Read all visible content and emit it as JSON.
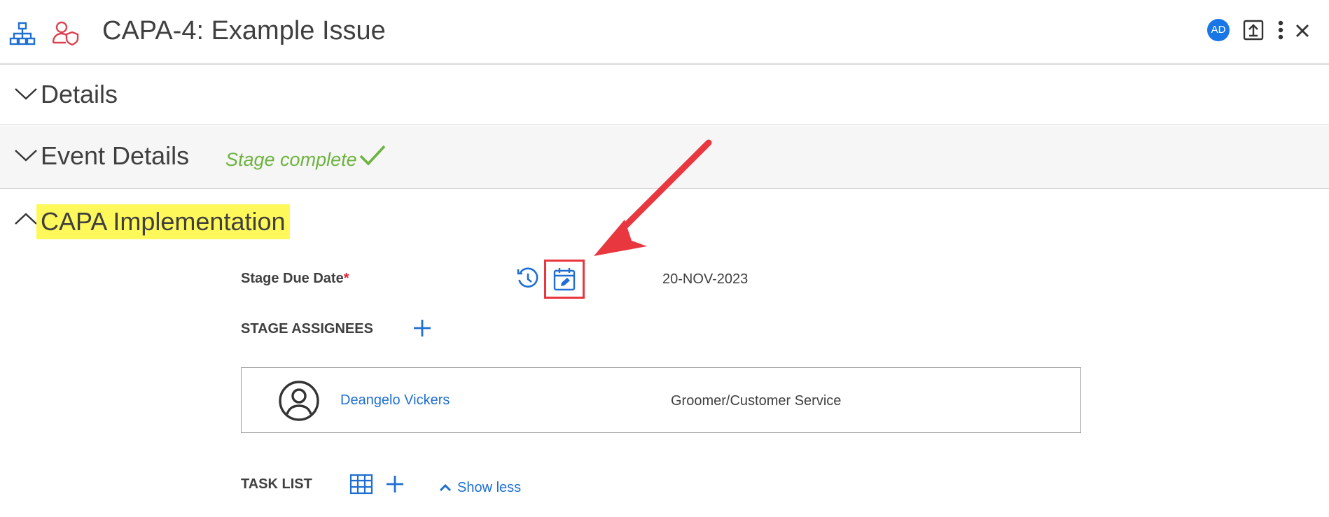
{
  "header": {
    "title": "CAPA-4: Example Issue",
    "avatar_initials": "AD",
    "icons": [
      "org-chart-icon",
      "user-shield-icon",
      "export-icon",
      "kebab-menu-icon",
      "close-icon"
    ]
  },
  "sections": {
    "details": {
      "title": "Details",
      "state": "collapsed"
    },
    "event_details": {
      "title": "Event Details",
      "state": "collapsed",
      "status": "Stage complete"
    },
    "capa_implementation": {
      "title": "CAPA Implementation",
      "state": "expanded"
    }
  },
  "capa": {
    "stage_due_date_label": "Stage Due Date",
    "required_mark": "*",
    "stage_due_date_value": "20-NOV-2023",
    "stage_assignees_label": "STAGE ASSIGNEES",
    "assignee": {
      "name": "Deangelo Vickers",
      "role": "Groomer/Customer Service"
    },
    "task_list_label": "TASK LIST",
    "show_less_label": "Show less"
  },
  "colors": {
    "accent_blue": "#1f6fd1",
    "success_green": "#6db33f",
    "highlight_yellow": "#fff85a",
    "annotation_red": "#e8373e"
  }
}
